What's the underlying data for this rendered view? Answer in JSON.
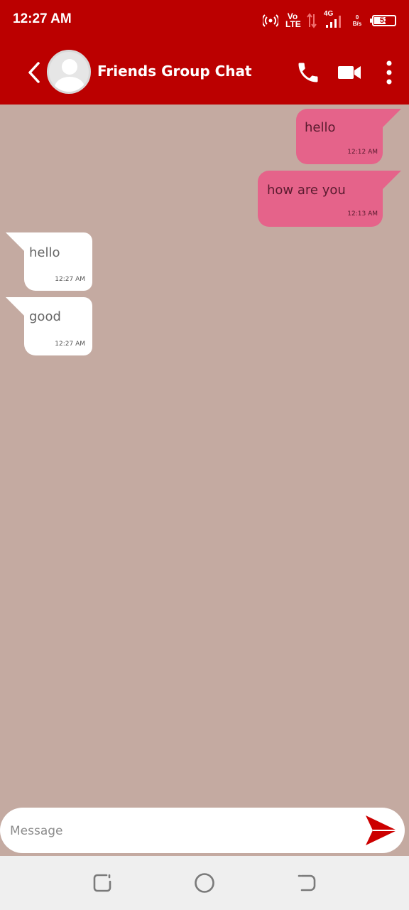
{
  "status": {
    "time": "12:27 AM",
    "volte": "Vo\nLTE",
    "network": "4G",
    "speed_value": "0",
    "speed_unit": "B/s",
    "battery": "53"
  },
  "header": {
    "title": "Friends Group Chat"
  },
  "messages": [
    {
      "direction": "out",
      "text": "hello",
      "time": "12:12 AM"
    },
    {
      "direction": "out",
      "text": "how are you",
      "time": "12:13 AM"
    },
    {
      "direction": "in",
      "text": "hello",
      "time": "12:27 AM"
    },
    {
      "direction": "in",
      "text": "good",
      "time": "12:27 AM"
    }
  ],
  "composer": {
    "placeholder": "Message"
  },
  "colors": {
    "header": "#bb0000",
    "background": "#c4aaa1",
    "outgoing_bubble": "#e5638a",
    "incoming_bubble": "#ffffff",
    "send_icon": "#cc0000"
  }
}
